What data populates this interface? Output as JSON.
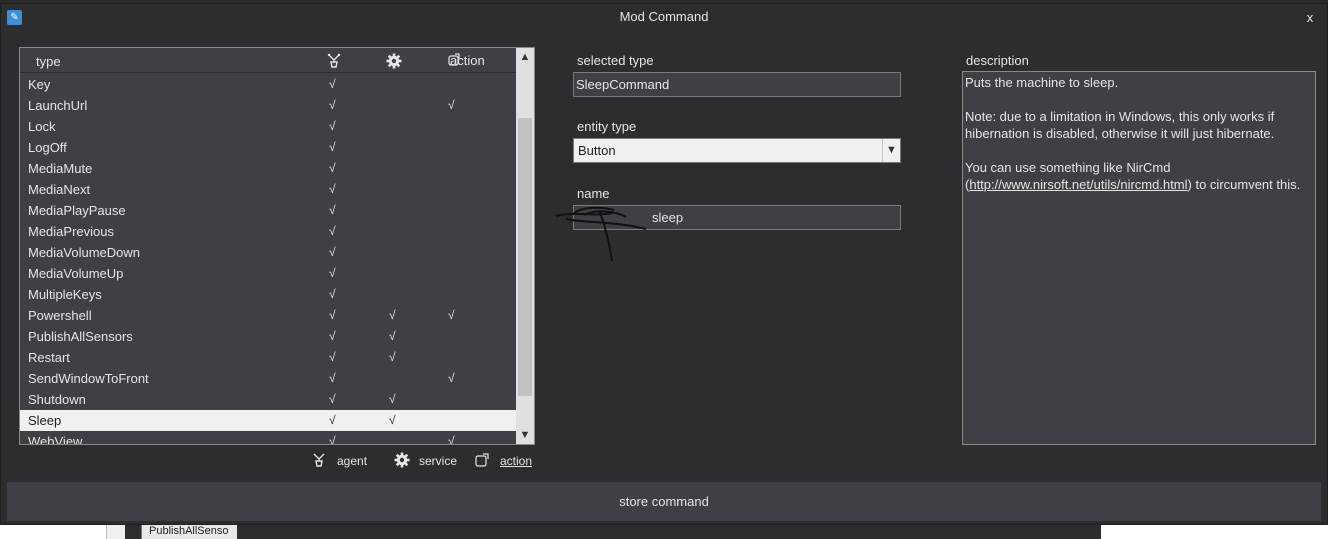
{
  "window": {
    "title": "Mod Command",
    "close_label": "x"
  },
  "list": {
    "headers": {
      "type": "type",
      "action": "action"
    },
    "check_mark": "√",
    "rows": [
      {
        "name": "Key",
        "agent": "√",
        "service": "",
        "action": ""
      },
      {
        "name": "LaunchUrl",
        "agent": "√",
        "service": "",
        "action": "√"
      },
      {
        "name": "Lock",
        "agent": "√",
        "service": "",
        "action": ""
      },
      {
        "name": "LogOff",
        "agent": "√",
        "service": "",
        "action": ""
      },
      {
        "name": "MediaMute",
        "agent": "√",
        "service": "",
        "action": ""
      },
      {
        "name": "MediaNext",
        "agent": "√",
        "service": "",
        "action": ""
      },
      {
        "name": "MediaPlayPause",
        "agent": "√",
        "service": "",
        "action": ""
      },
      {
        "name": "MediaPrevious",
        "agent": "√",
        "service": "",
        "action": ""
      },
      {
        "name": "MediaVolumeDown",
        "agent": "√",
        "service": "",
        "action": ""
      },
      {
        "name": "MediaVolumeUp",
        "agent": "√",
        "service": "",
        "action": ""
      },
      {
        "name": "MultipleKeys",
        "agent": "√",
        "service": "",
        "action": ""
      },
      {
        "name": "Powershell",
        "agent": "√",
        "service": "√",
        "action": "√"
      },
      {
        "name": "PublishAllSensors",
        "agent": "√",
        "service": "√",
        "action": ""
      },
      {
        "name": "Restart",
        "agent": "√",
        "service": "√",
        "action": ""
      },
      {
        "name": "SendWindowToFront",
        "agent": "√",
        "service": "",
        "action": "√"
      },
      {
        "name": "Shutdown",
        "agent": "√",
        "service": "√",
        "action": ""
      },
      {
        "name": "Sleep",
        "agent": "√",
        "service": "√",
        "action": "",
        "selected": true
      },
      {
        "name": "WebView",
        "agent": "√",
        "service": "",
        "action": "√"
      }
    ]
  },
  "legend": {
    "agent": "agent",
    "service": "service",
    "action": "action"
  },
  "form": {
    "selected_type_label": "selected type",
    "selected_type_value": "SleepCommand",
    "entity_type_label": "entity type",
    "entity_type_value": "Button",
    "name_label": "name",
    "name_value": "sleep"
  },
  "description": {
    "label": "description",
    "line1": "Puts the machine to sleep.",
    "line2": "Note: due to a limitation in Windows, this only works if hibernation is disabled, otherwise it will just hibernate.",
    "line3_prefix": "You can use something like NirCmd (",
    "link": "http://www.nirsoft.net/utils/nircmd.html",
    "line3_suffix": ") to circumvent this."
  },
  "store_button": "store command",
  "background": {
    "taskbar_item": "PublishAllSenso"
  },
  "colors": {
    "window_bg": "#2d2d30",
    "panel_bg": "#3f3f46",
    "selection": "#f0f0f0"
  }
}
